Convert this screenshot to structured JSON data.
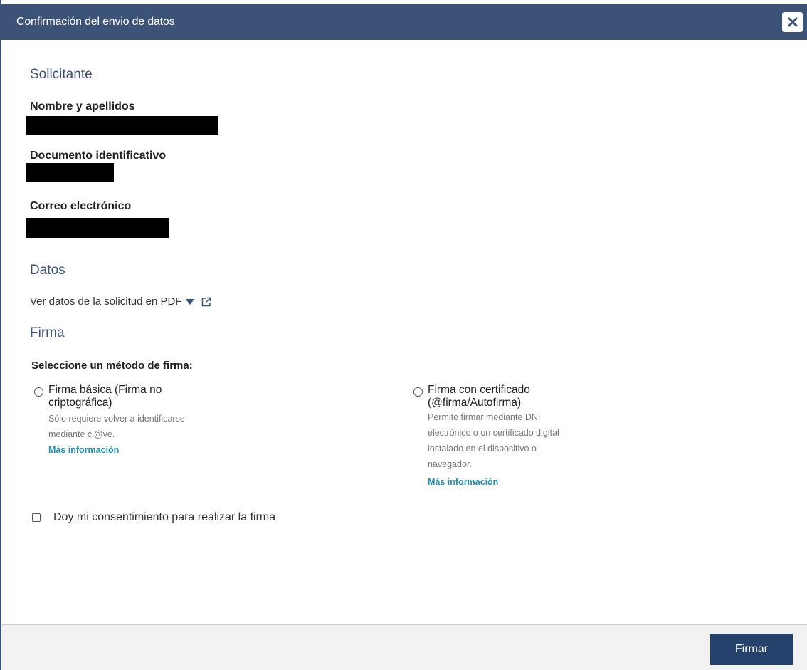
{
  "dialog": {
    "title": "Confirmación del envio de datos",
    "close_icon": "close-icon"
  },
  "solicitante": {
    "heading": "Solicitante",
    "name_label": "Nombre y apellidos",
    "doc_label": "Documento identificativo",
    "email_label": "Correo electrónico"
  },
  "datos": {
    "heading": "Datos",
    "pdf_link": "Ver datos de la solicitud en PDF",
    "pdf_icons": [
      "caret-down-icon",
      "external-link-icon"
    ]
  },
  "firma": {
    "heading": "Firma",
    "method_label": "Seleccione un método de firma:",
    "options": [
      {
        "title_line1": "Firma básica (Firma no",
        "title_line2": "criptográfica)",
        "desc": [
          "Sólo requiere volver a identificarse",
          "mediante cl@ve."
        ],
        "link": "Más información"
      },
      {
        "title_line1": "Firma con certificado",
        "title_line2": "(@firma/Autofirma)",
        "desc": [
          "Permite firmar mediante DNI",
          "electrónico o un certificado digital",
          "instalado en el dispositivo o",
          "navegador."
        ],
        "link": "Más información"
      }
    ],
    "consent_label": "Doy mi consentimiento para realizar la firma"
  },
  "footer": {
    "submit_label": "Firmar"
  },
  "colors": {
    "header": "#3d5277",
    "accent": "#3d5277",
    "link": "#1f8fb3",
    "button": "#24426b"
  }
}
